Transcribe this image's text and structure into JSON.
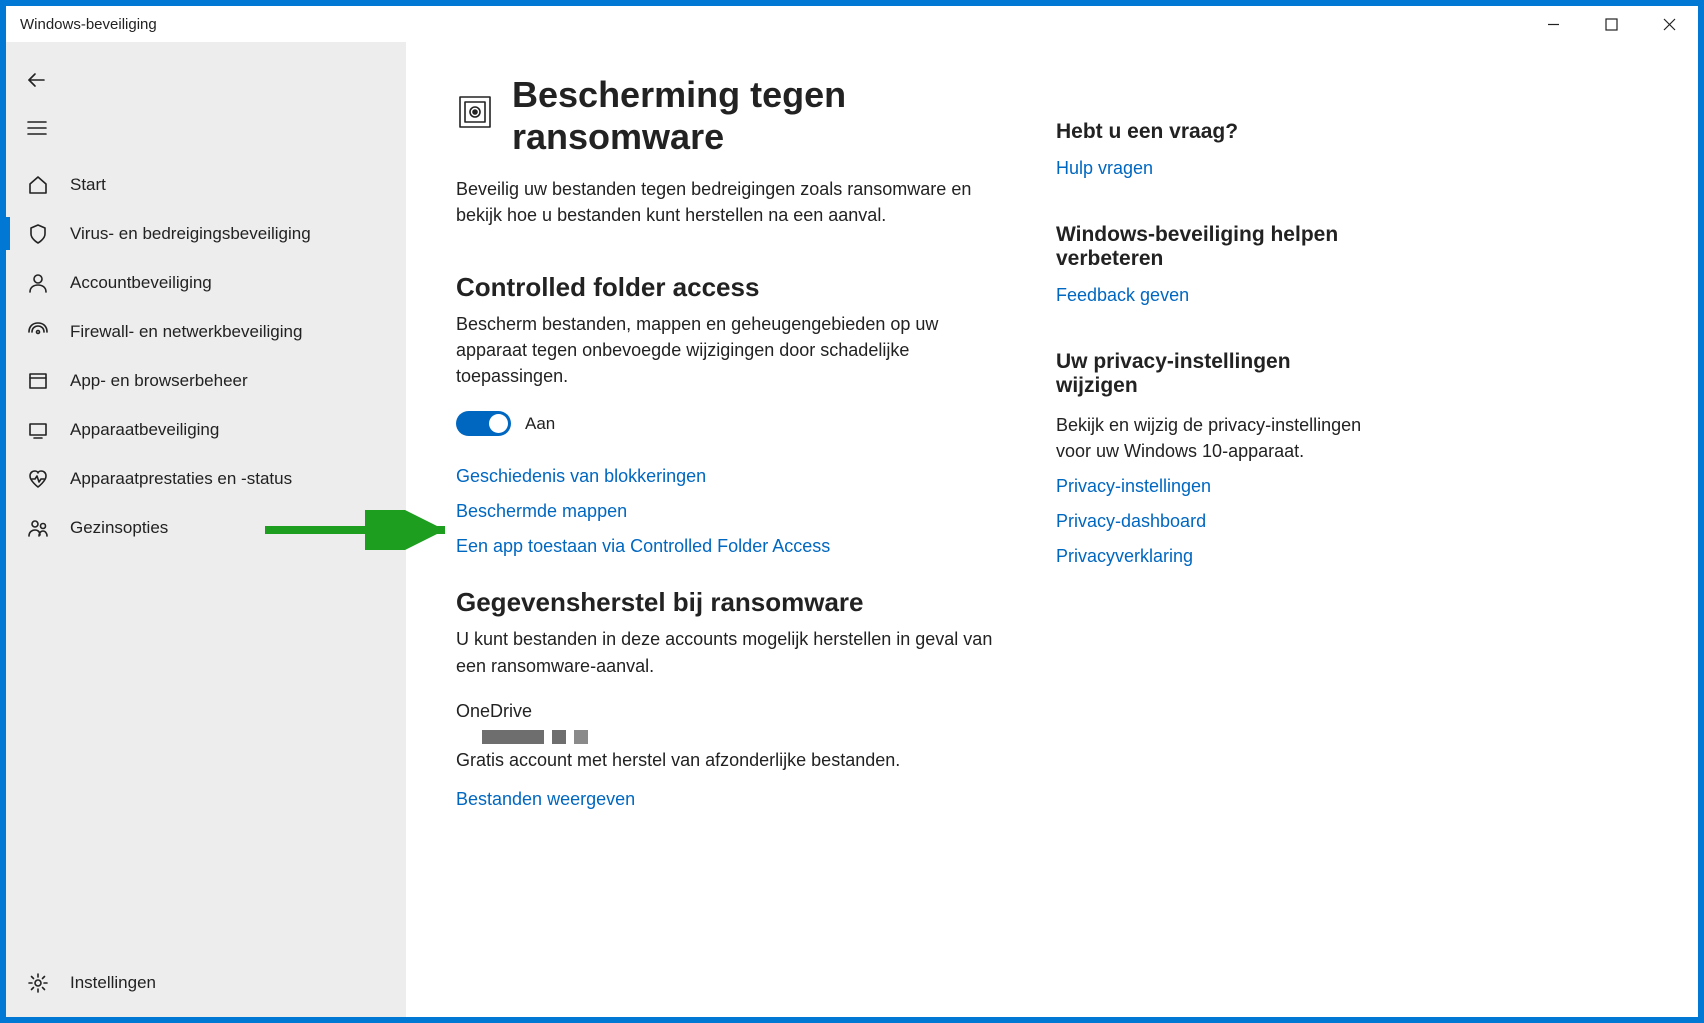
{
  "titlebar": {
    "title": "Windows-beveiliging"
  },
  "sidebar": {
    "items": [
      {
        "label": "Start"
      },
      {
        "label": "Virus- en bedreigingsbeveiliging"
      },
      {
        "label": "Accountbeveiliging"
      },
      {
        "label": "Firewall- en netwerkbeveiliging"
      },
      {
        "label": "App- en browserbeheer"
      },
      {
        "label": "Apparaatbeveiliging"
      },
      {
        "label": "Apparaatprestaties en -status"
      },
      {
        "label": "Gezinsopties"
      }
    ],
    "settings": "Instellingen"
  },
  "page": {
    "title": "Bescherming tegen ransomware",
    "desc": "Beveilig uw bestanden tegen bedreigingen zoals ransomware en bekijk hoe u bestanden kunt herstellen na een aanval."
  },
  "cfa": {
    "heading": "Controlled folder access",
    "desc": "Bescherm bestanden, mappen en geheugengebieden op uw apparaat tegen onbevoegde wijzigingen door schadelijke toepassingen.",
    "toggle_label": "Aan",
    "links": {
      "history": "Geschiedenis van blokkeringen",
      "protected": "Beschermde mappen",
      "allow_app": "Een app toestaan via Controlled Folder Access"
    }
  },
  "recovery": {
    "heading": "Gegevensherstel bij ransomware",
    "desc": "U kunt bestanden in deze accounts mogelijk herstellen in geval van een ransomware-aanval.",
    "onedrive": "OneDrive",
    "onedrive_desc": "Gratis account met herstel van afzonderlijke bestanden.",
    "view_files": "Bestanden weergeven"
  },
  "right": {
    "help": {
      "heading": "Hebt u een vraag?",
      "link": "Hulp vragen"
    },
    "improve": {
      "heading": "Windows-beveiliging helpen verbeteren",
      "link": "Feedback geven"
    },
    "privacy": {
      "heading": "Uw privacy-instellingen wijzigen",
      "desc": "Bekijk en wijzig de privacy-instellingen voor uw Windows 10-apparaat.",
      "links": {
        "settings": "Privacy-instellingen",
        "dashboard": "Privacy-dashboard",
        "statement": "Privacyverklaring"
      }
    }
  }
}
